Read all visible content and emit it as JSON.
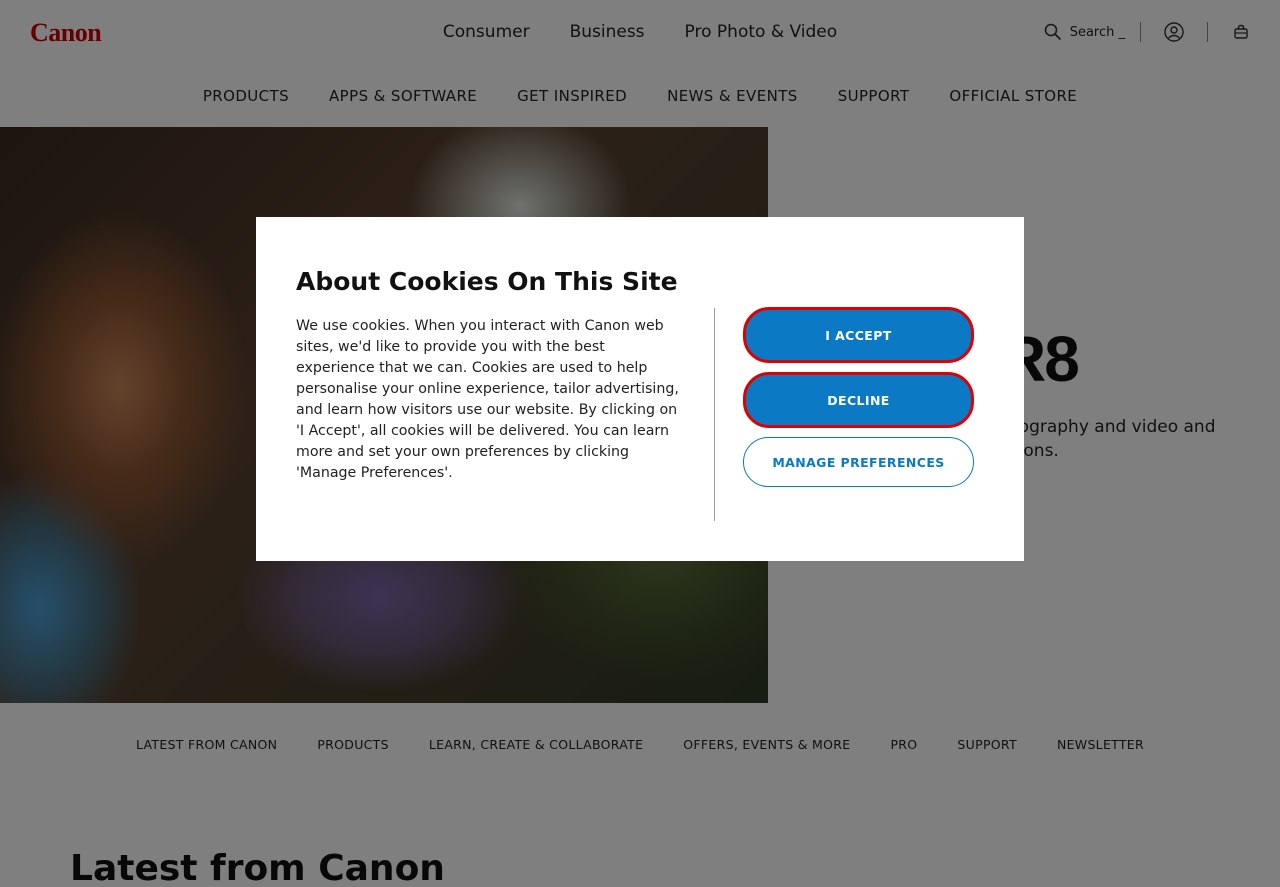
{
  "header": {
    "logo": "Canon",
    "segments": [
      "Consumer",
      "Business",
      "Pro Photo & Video"
    ],
    "search_label": "Search _",
    "icons": {
      "search": "search-icon",
      "account": "user-circle-icon",
      "basket": "shopping-bag-icon"
    }
  },
  "main_nav": [
    "PRODUCTS",
    "APPS & SOFTWARE",
    "GET INSPIRED",
    "NEWS & EVENTS",
    "SUPPORT",
    "OFFICIAL STORE"
  ],
  "hero": {
    "title_visible": "R8",
    "text_line1": "tography and video and",
    "text_line2": "tions."
  },
  "secondary_nav": [
    "LATEST FROM CANON",
    "PRODUCTS",
    "LEARN, CREATE & COLLABORATE",
    "OFFERS, EVENTS & MORE",
    "PRO",
    "SUPPORT",
    "NEWSLETTER"
  ],
  "latest_heading": "Latest from Canon",
  "cookie_modal": {
    "title": "About Cookies On This Site",
    "body": "We use cookies. When you interact with Canon web sites, we'd like to provide you with the best experience that we can. Cookies are used to help personalise your online experience, tailor advertising, and learn how visitors use our website. By clicking on 'I Accept', all cookies will be delivered. You can learn more and set your own preferences by clicking 'Manage Preferences'.",
    "accept_label": "I ACCEPT",
    "decline_label": "DECLINE",
    "manage_label": "MANAGE PREFERENCES"
  },
  "colors": {
    "brand_red": "#cc0000",
    "button_blue": "#0b79c4",
    "focus_ring": "#e00000",
    "overlay": "rgba(0,0,0,0.5)"
  }
}
